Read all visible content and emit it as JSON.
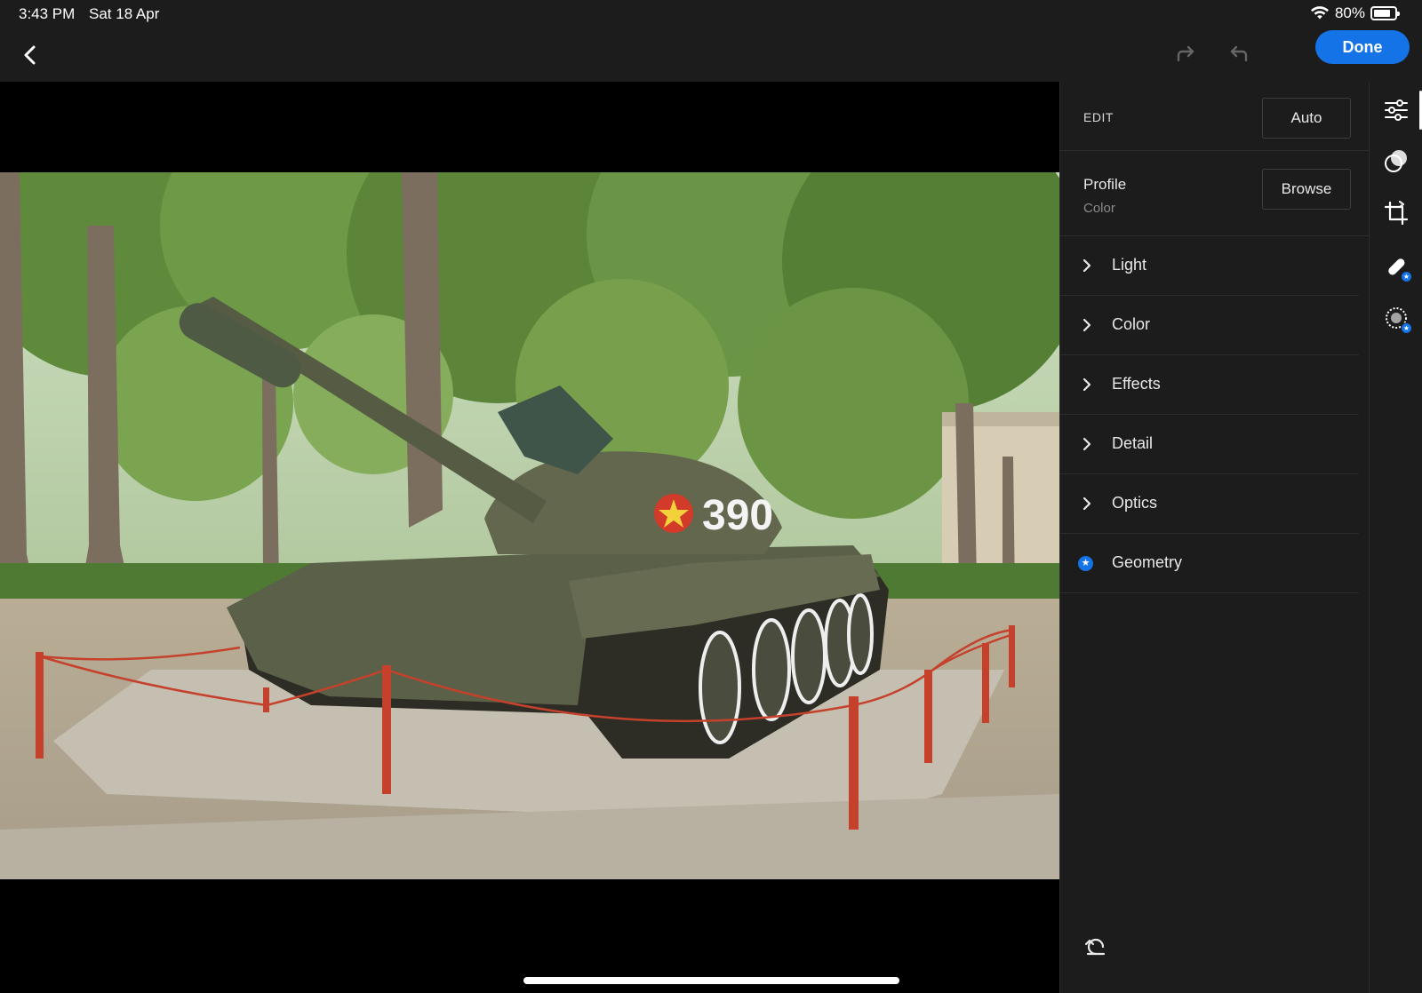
{
  "status_bar": {
    "time": "3:43 PM",
    "date": "Sat 18 Apr",
    "battery_percent": "80%",
    "battery_level": 0.8
  },
  "top_bar": {
    "back_icon": "chevron-left-icon",
    "redo_icon": "redo-icon",
    "undo_icon": "undo-icon",
    "done_label": "Done",
    "accent_color": "#1473e6"
  },
  "photo": {
    "tank_number": "390"
  },
  "edit_panel": {
    "header_label": "EDIT",
    "auto_label": "Auto",
    "profile": {
      "title": "Profile",
      "value": "Color",
      "browse_label": "Browse"
    },
    "sections": [
      {
        "label": "Light",
        "icon": "chevron-right-icon"
      },
      {
        "label": "Color",
        "icon": "chevron-right-icon"
      },
      {
        "label": "Effects",
        "icon": "chevron-right-icon"
      },
      {
        "label": "Detail",
        "icon": "chevron-right-icon"
      },
      {
        "label": "Optics",
        "icon": "chevron-right-icon"
      },
      {
        "label": "Geometry",
        "icon": "premium-star-icon"
      }
    ],
    "reset_icon": "reset-icon"
  },
  "tool_strip": {
    "tools": [
      {
        "name": "edit-sliders-icon",
        "active": true
      },
      {
        "name": "masking-icon",
        "active": false
      },
      {
        "name": "crop-icon",
        "active": false
      },
      {
        "name": "healing-icon",
        "premium": true
      },
      {
        "name": "remove-icon",
        "premium": true
      }
    ]
  }
}
